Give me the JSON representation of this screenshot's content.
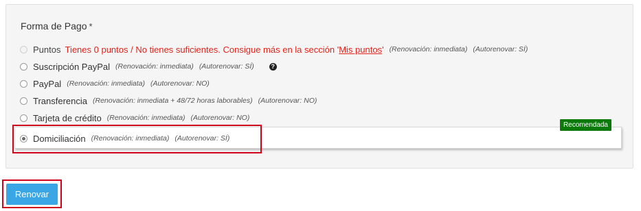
{
  "form": {
    "title": "Forma de Pago",
    "required_mark": "*",
    "options": [
      {
        "label": "Puntos",
        "warning_prefix": "Tienes 0 puntos / No tienes suficientes. Consigue más en la sección '",
        "warning_link": "Mis puntos",
        "warning_suffix": "'",
        "renewal": "(Renovación: inmediata)",
        "autorenew": "(Autorenovar: SÍ)",
        "state": "disabled"
      },
      {
        "label": "Suscripción PayPal",
        "renewal": "(Renovación: inmediata)",
        "autorenew": "(Autorenovar: SÍ)",
        "help_icon": "?",
        "state": "unchecked"
      },
      {
        "label": "PayPal",
        "renewal": "(Renovación: inmediata)",
        "autorenew": "(Autorenovar: NO)",
        "state": "unchecked"
      },
      {
        "label": "Transferencia",
        "renewal": "(Renovación: inmediata + 48/72 horas laborables)",
        "autorenew": "(Autorenovar: NO)",
        "state": "unchecked"
      },
      {
        "label": "Tarjeta de crédito",
        "renewal": "(Renovación: inmediata)",
        "autorenew": "(Autorenovar: NO)",
        "state": "unchecked"
      },
      {
        "label": "Domiciliación",
        "renewal": "(Renovación: inmediata)",
        "autorenew": "(Autorenovar: SÍ)",
        "badge": "Recomendada",
        "state": "checked"
      }
    ]
  },
  "submit": {
    "label": "Renovar"
  },
  "colors": {
    "warning": "#e0241b",
    "badge": "#0b7a0b",
    "button": "#3aa6e6",
    "highlight": "#d0021b"
  }
}
